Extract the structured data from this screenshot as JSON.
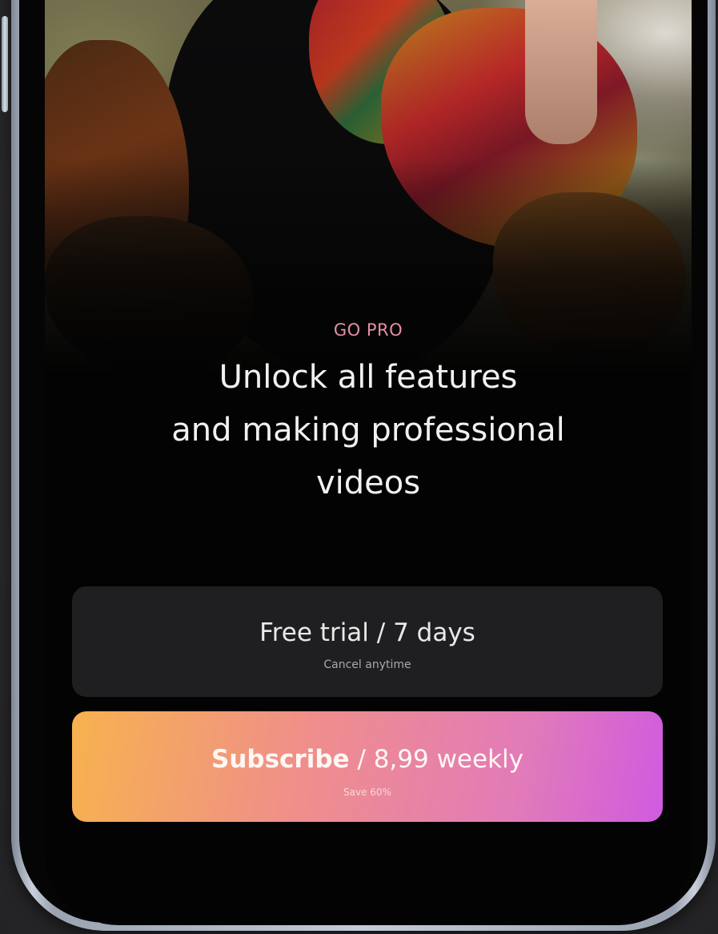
{
  "paywall": {
    "eyebrow": "GO PRO",
    "headline_line1": "Unlock all features",
    "headline_line2": "and making professional",
    "headline_line3": "videos"
  },
  "trial_option": {
    "title": "Free trial / 7 days",
    "caption": "Cancel anytime"
  },
  "subscribe_option": {
    "title_bold": "Subscribe",
    "title_rest": " / 8,99 weekly",
    "caption": "Save 60%"
  },
  "colors": {
    "accent_eyebrow": "#e58fa6",
    "gradient_start": "#f7b24e",
    "gradient_end": "#cf5be0",
    "card_dark": "#1f1f21"
  }
}
